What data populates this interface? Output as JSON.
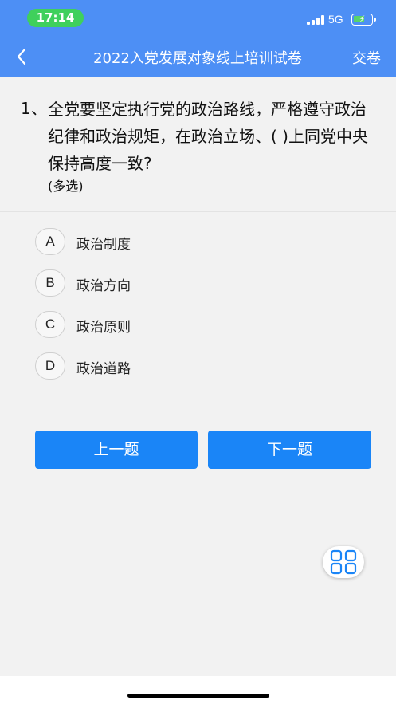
{
  "status_bar": {
    "time": "17:14",
    "network": "5G",
    "battery_level": 0.5,
    "time_pill_color": "#3fd05c"
  },
  "header": {
    "title": "2022入党发展对象线上培训试卷",
    "submit_label": "交卷",
    "back_icon": "chevron-left-icon",
    "background_color": "#4d8ff5"
  },
  "question": {
    "number": "1、",
    "text": "全党要坚定执行党的政治路线，严格遵守政治纪律和政治规矩，在政治立场、( )上同党中央保持高度一致?",
    "type": "(多选)"
  },
  "options": [
    {
      "letter": "A",
      "text": "政治制度"
    },
    {
      "letter": "B",
      "text": "政治方向"
    },
    {
      "letter": "C",
      "text": "政治原则"
    },
    {
      "letter": "D",
      "text": "政治道路"
    }
  ],
  "navigation": {
    "prev_label": "上一题",
    "next_label": "下一题",
    "button_color": "#1a85f7"
  },
  "fab": {
    "icon": "grid-icon"
  }
}
